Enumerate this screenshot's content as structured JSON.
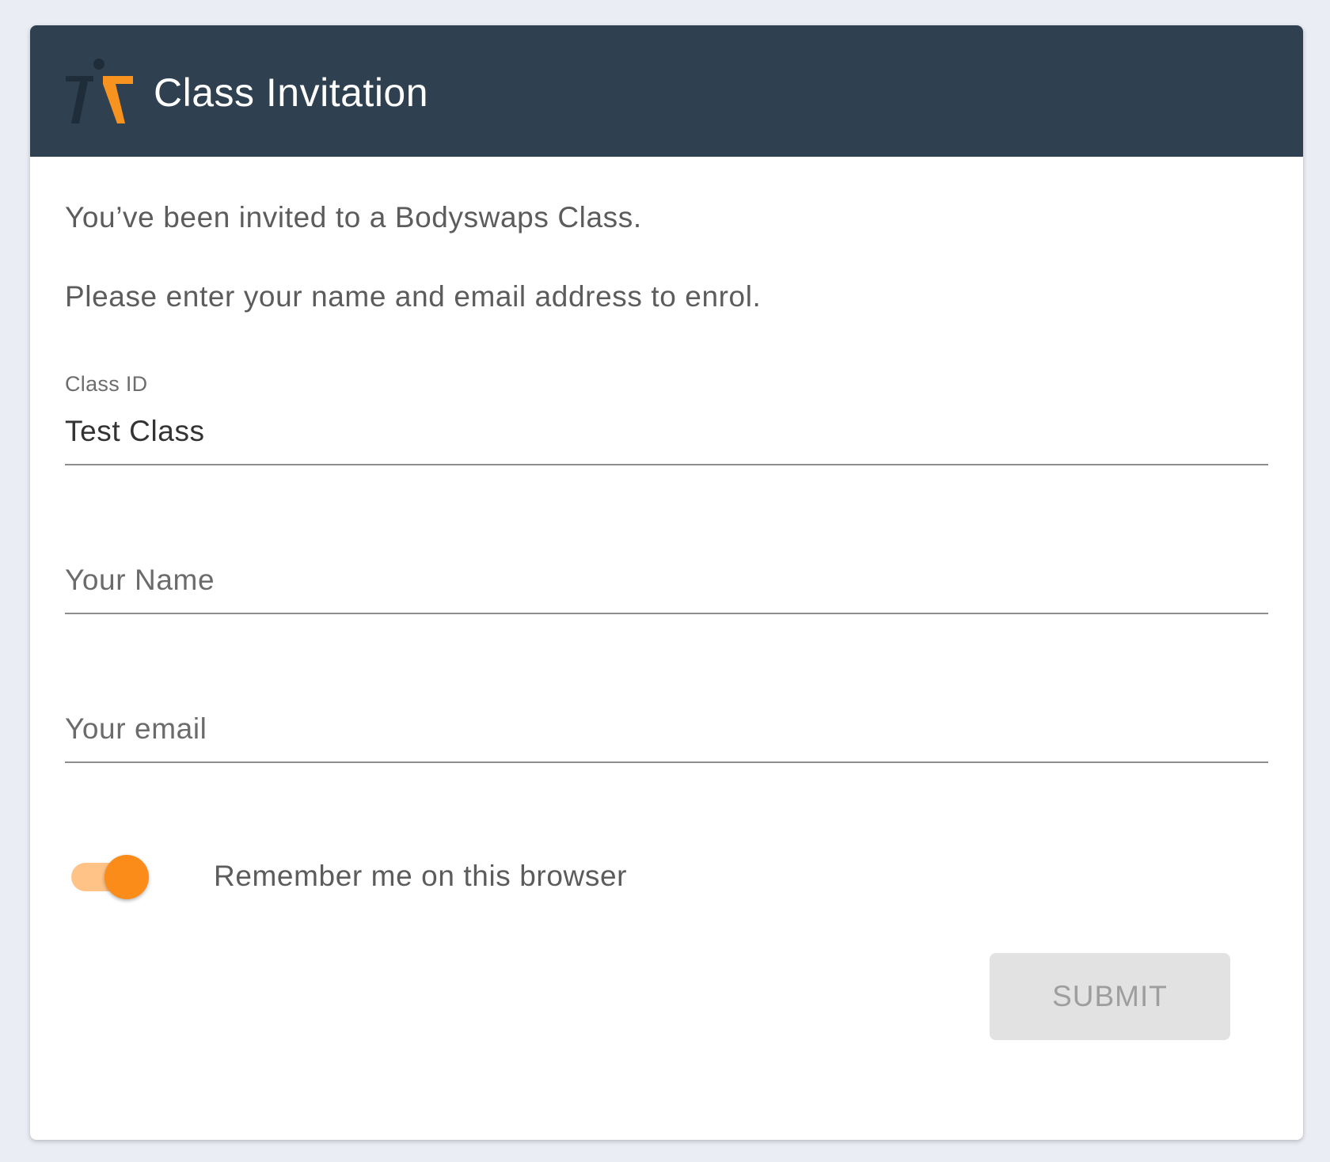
{
  "header": {
    "title": "Class Invitation",
    "logo_icon": "bodyswaps-logo-icon",
    "background_color": "#2f4050",
    "logo_colors": [
      "#1f2d3a",
      "#f7931e"
    ]
  },
  "intro": {
    "line1": "You’ve been invited to a Bodyswaps Class.",
    "line2": "Please enter your name and email address to enrol."
  },
  "form": {
    "class_id": {
      "label": "Class ID",
      "value": "Test Class"
    },
    "name": {
      "placeholder": "Your Name",
      "value": ""
    },
    "email": {
      "placeholder": "Your email",
      "value": ""
    },
    "remember": {
      "label": "Remember me on this browser",
      "checked": true,
      "accent_color": "#fb8c1a"
    },
    "submit": {
      "label": "SUBMIT",
      "disabled": true
    }
  }
}
